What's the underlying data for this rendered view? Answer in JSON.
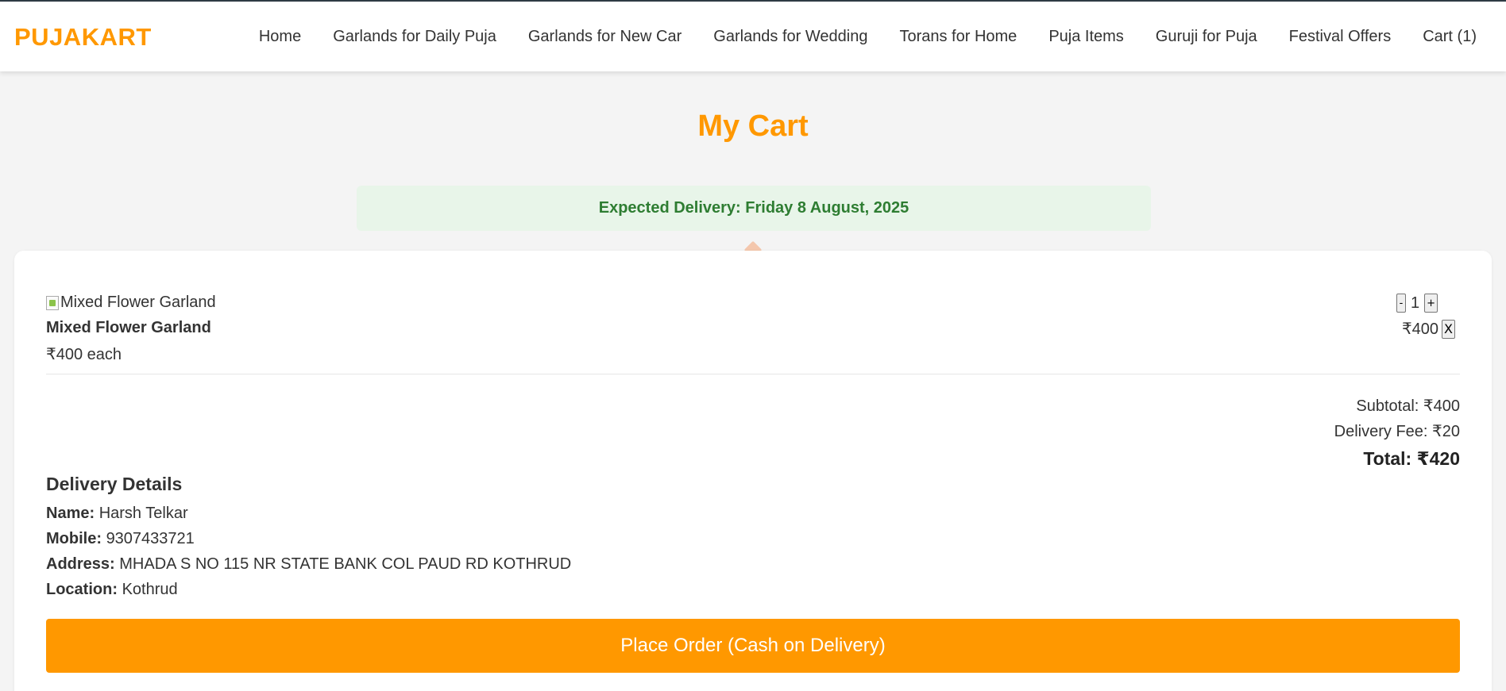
{
  "header": {
    "logo": "PUJAKART",
    "nav": [
      "Home",
      "Garlands for Daily Puja",
      "Garlands for New Car",
      "Garlands for Wedding",
      "Torans for Home",
      "Puja Items",
      "Guruji for Puja",
      "Festival Offers",
      "Cart (1)"
    ]
  },
  "page": {
    "title": "My Cart",
    "delivery_banner": "Expected Delivery: Friday 8 August, 2025"
  },
  "cart": {
    "items": [
      {
        "image_alt": "Mixed Flower Garland",
        "name": "Mixed Flower Garland",
        "unit_price": "₹400 each",
        "decrement_label": "-",
        "quantity": "1",
        "increment_label": "+",
        "line_total": "₹400",
        "remove_label": "X"
      }
    ],
    "subtotal": "Subtotal: ₹400",
    "delivery_fee": "Delivery Fee: ₹20",
    "total": "Total: ₹420"
  },
  "delivery": {
    "heading": "Delivery Details",
    "name_label": "Name:",
    "name": "Harsh Telkar",
    "mobile_label": "Mobile:",
    "mobile": "9307433721",
    "address_label": "Address:",
    "address": "MHADA S NO 115 NR STATE BANK COL PAUD RD KOTHRUD",
    "location_label": "Location:",
    "location": "Kothrud"
  },
  "actions": {
    "place_order": "Place Order (Cash on Delivery)"
  },
  "colors": {
    "brand": "#ff9800",
    "banner_bg": "#e8f5e9",
    "banner_text": "#2e7d32",
    "page_bg": "#f4f4f4"
  }
}
